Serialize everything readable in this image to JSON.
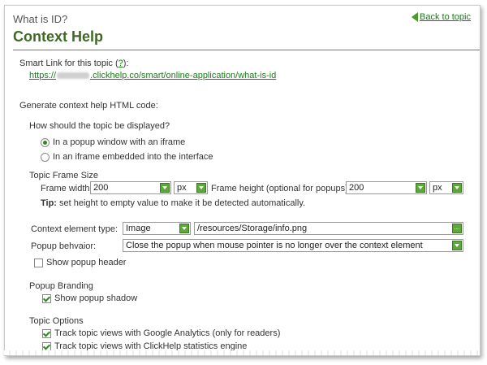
{
  "header": {
    "subtitle": "What is ID?",
    "title": "Context Help",
    "back_link": "Back to topic"
  },
  "smart_link": {
    "label_prefix": "Smart Link for this topic (",
    "help": "?",
    "label_suffix": "):",
    "url_start": "https://",
    "url_end": ".clickhelp.co/smart/online-application/what-is-id"
  },
  "generate_label": "Generate context help HTML code:",
  "display": {
    "question": "How should the topic be displayed?",
    "option1": "In a popup window with an iframe",
    "option2": "In an iframe embedded into the interface"
  },
  "frame_size": {
    "heading": "Topic Frame Size",
    "width_label": "Frame width:",
    "width_value": "200",
    "width_unit": "px",
    "height_label": "Frame height (optional for popups):",
    "height_value": "200",
    "height_unit": "px",
    "tip_bold": "Tip:",
    "tip_text": " set height to empty value to make it be detected automatically."
  },
  "context": {
    "type_label": "Context element type:",
    "type_value": "Image",
    "path_value": "/resources/Storage/info.png",
    "dots": "...",
    "behavior_label": "Popup behvaior:",
    "behavior_value": "Close the popup when mouse pointer is no longer over the context element",
    "show_header": "Show popup header"
  },
  "branding": {
    "heading": "Popup Branding",
    "shadow": "Show popup shadow"
  },
  "options": {
    "heading": "Topic Options",
    "ga": "Track topic views with Google Analytics (only for readers)",
    "ch": "Track topic views with ClickHelp statistics engine"
  },
  "colors": {
    "accent": "#4c9a2a",
    "title": "#3d6b24",
    "link": "#1a7a1a"
  }
}
